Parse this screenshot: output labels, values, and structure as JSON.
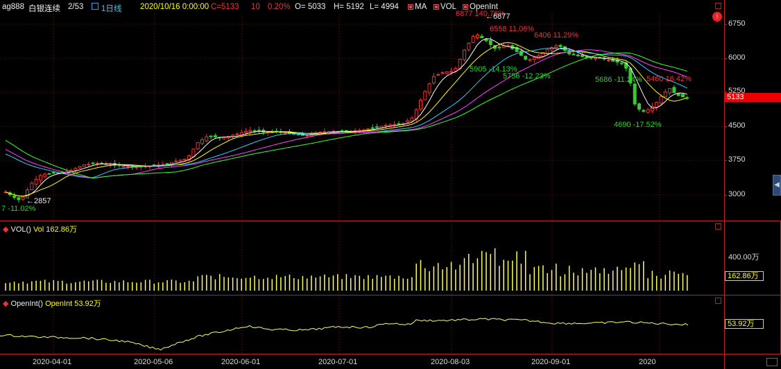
{
  "header": {
    "symbol": "ag888",
    "name": "白银连续",
    "page": "2/53",
    "period": "1日线",
    "datetime": "2020/10/16 0:00:00",
    "close_label": "C=",
    "close": "5133",
    "change": "10",
    "change_pct": "0.20%",
    "open": "O= 5033",
    "high": "H= 5192",
    "low": "L= 4994",
    "ma_label": "MA",
    "vol_label": "VOL",
    "oi_label": "OpenInt"
  },
  "price_axis": [
    "6750",
    "6000",
    "5250",
    "4500",
    "3750",
    "3000"
  ],
  "current_price_tag": "5133",
  "annotations": [
    {
      "text": "6877 140.76%",
      "cls": "red"
    },
    {
      "text": "6877",
      "cls": "white"
    },
    {
      "text": "6558 11.06%",
      "cls": "red"
    },
    {
      "text": "6406 11.29%",
      "cls": "red"
    },
    {
      "text": "5905 -14.13%",
      "cls": "green"
    },
    {
      "text": "5756 -12.23%",
      "cls": "green"
    },
    {
      "text": "5686 -11.24%",
      "cls": "green"
    },
    {
      "text": "5460 16.42%",
      "cls": "red"
    },
    {
      "text": "4690 -17.52%",
      "cls": "green"
    },
    {
      "text": "2857",
      "cls": "white"
    },
    {
      "text": "7 -11.02%",
      "cls": "green"
    }
  ],
  "volume_panel": {
    "title": "VOL()",
    "value_label": "Vol",
    "value": "162.86万",
    "axis_label": "400.00万",
    "current_tag": "162.86万"
  },
  "oi_panel": {
    "title": "OpenInt()",
    "value_label": "OpenInt",
    "value": "53.92万",
    "current_tag": "53.92万"
  },
  "date_axis": [
    "2020-04-01",
    "2020-05-06",
    "2020-06-01",
    "2020-07-01",
    "2020-08-03",
    "2020-09-01",
    "2020"
  ],
  "colors": {
    "up": "#e33",
    "down": "#3c3",
    "ma1": "#ffffff",
    "ma2": "#ffff00",
    "ma3": "#ff44ff",
    "ma4": "#33ff33",
    "ma5": "#33ccff",
    "vol": "#ffff66",
    "oi": "#ffff66",
    "border": "#bb2222"
  }
}
